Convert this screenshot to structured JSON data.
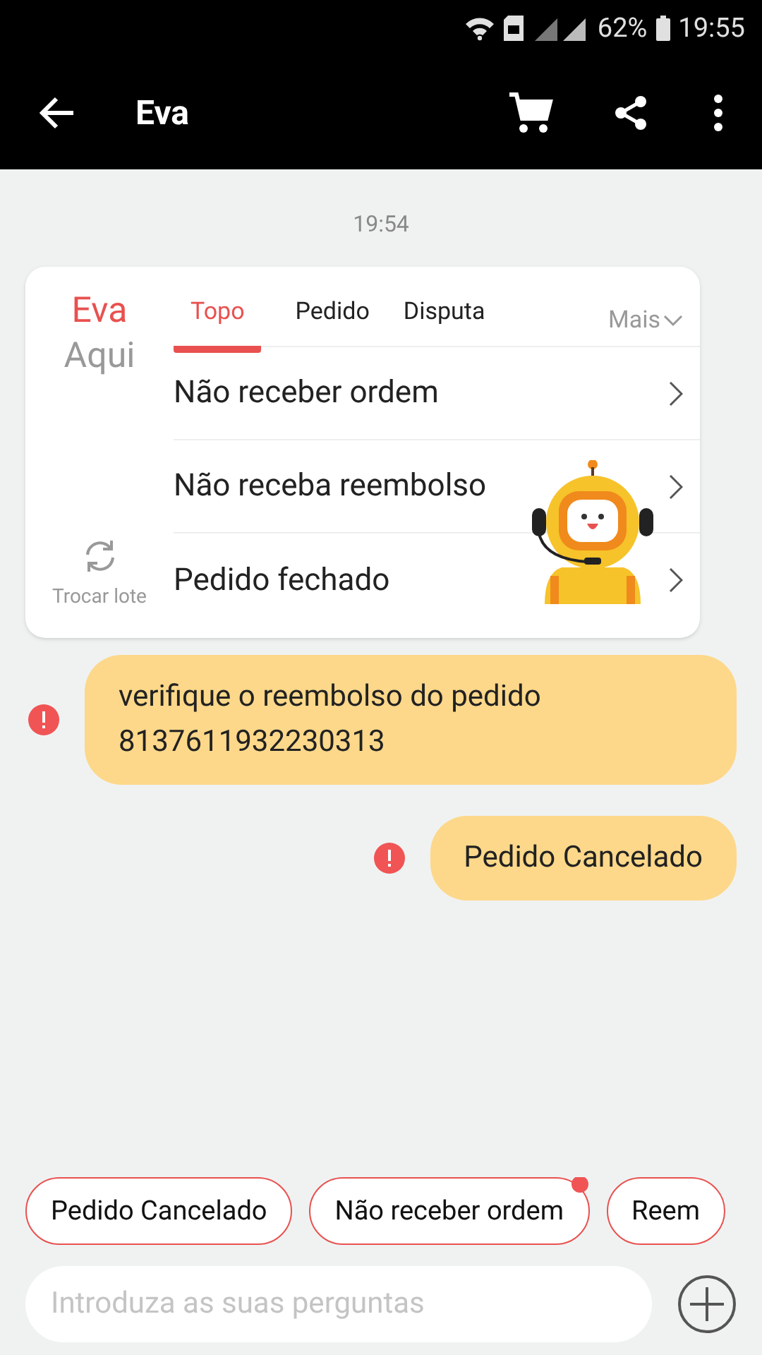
{
  "status_bar": {
    "battery": "62%",
    "time": "19:55"
  },
  "header": {
    "title": "Eva"
  },
  "timestamp": "19:54",
  "card": {
    "brand": "Eva",
    "brand_sub": "Aqui",
    "refresh_label": "Trocar lote",
    "more": "Mais",
    "tabs": [
      {
        "label": "Topo",
        "selected": true
      },
      {
        "label": "Pedido",
        "selected": false
      },
      {
        "label": "Disputa",
        "selected": false
      }
    ],
    "items": [
      "Não receber ordem",
      "Não receba reembolso",
      "Pedido fechado"
    ]
  },
  "messages": [
    {
      "text": "verifique o reembolso do pedido 8137611932230313",
      "failed": true
    },
    {
      "text": "Pedido Cancelado",
      "failed": true
    }
  ],
  "quick_replies": [
    {
      "label": "Pedido Cancelado",
      "dot": false
    },
    {
      "label": "Não receber ordem",
      "dot": true
    },
    {
      "label": "Reem",
      "dot": false
    }
  ],
  "input": {
    "placeholder": "Introduza as suas perguntas"
  }
}
